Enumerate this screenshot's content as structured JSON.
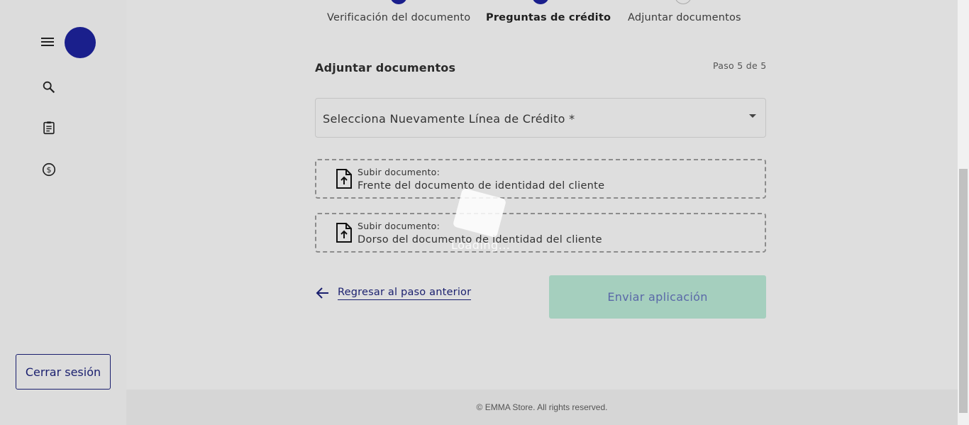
{
  "sidebar": {
    "logout_label": "Cerrar sesión",
    "icons": [
      "menu-icon",
      "search-icon",
      "clipboard-icon",
      "dollar-icon"
    ]
  },
  "stepper": {
    "steps": [
      {
        "label": "Verificación del documento",
        "state": "done"
      },
      {
        "label": "Preguntas de crédito",
        "state": "active"
      },
      {
        "label": "Adjuntar documentos",
        "state": "pending"
      }
    ]
  },
  "form": {
    "title": "Adjuntar documentos",
    "step_count": "Paso 5 de 5",
    "select_label": "Selecciona Nuevamente Línea de Crédito *",
    "uploads": [
      {
        "caption": "Subir documento:",
        "name": "Frente del documento de identidad del cliente"
      },
      {
        "caption": "Subir documento:",
        "name": "Dorso del documento de identidad del cliente"
      }
    ],
    "back_label": "Regresar al paso anterior",
    "submit_label": "Enviar aplicación"
  },
  "loader": {
    "text": "Loading..."
  },
  "footer": {
    "text": "© EMMA Store. All rights reserved."
  },
  "colors": {
    "primary": "#1a1f8c",
    "submit_bg": "#a5cfbe",
    "background": "#dedede"
  }
}
